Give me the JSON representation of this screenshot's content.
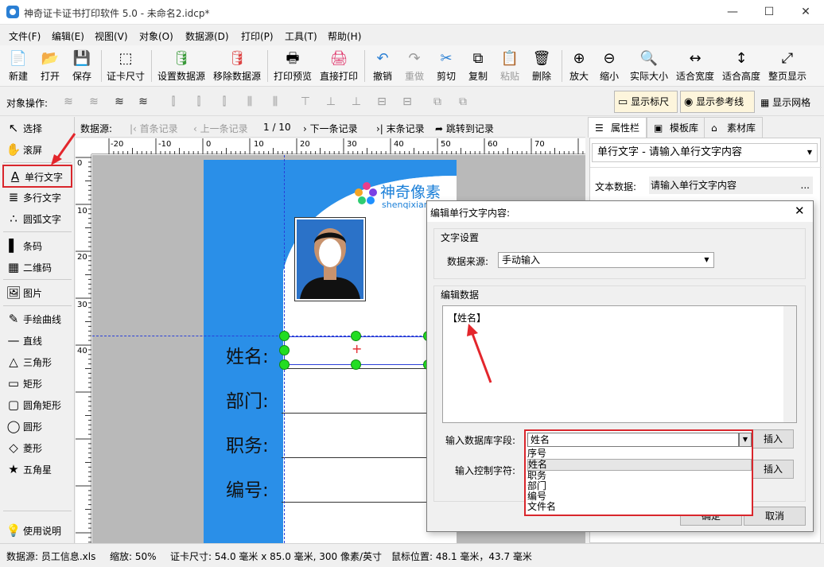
{
  "window": {
    "title": "神奇证卡证书打印软件 5.0 - 未命名2.idcp*",
    "min": "—",
    "max": "☐",
    "close": "✕"
  },
  "menu": [
    "文件(F)",
    "编辑(E)",
    "视图(V)",
    "对象(O)",
    "数据源(D)",
    "打印(P)",
    "工具(T)",
    "帮助(H)"
  ],
  "toolbar": [
    {
      "label": "新建",
      "icon": "📄"
    },
    {
      "label": "打开",
      "icon": "📂"
    },
    {
      "label": "保存",
      "icon": "💾"
    },
    {
      "label": "证卡尺寸",
      "icon": "⬚"
    },
    {
      "label": "设置数据源",
      "icon": "🛢"
    },
    {
      "label": "移除数据源",
      "icon": "🛢"
    },
    {
      "label": "打印预览",
      "icon": "🖶"
    },
    {
      "label": "直接打印",
      "icon": "🖨"
    },
    {
      "label": "撤销",
      "icon": "↶"
    },
    {
      "label": "重做",
      "icon": "↷"
    },
    {
      "label": "剪切",
      "icon": "✂"
    },
    {
      "label": "复制",
      "icon": "⧉"
    },
    {
      "label": "粘贴",
      "icon": "📋"
    },
    {
      "label": "删除",
      "icon": "🗑"
    },
    {
      "label": "放大",
      "icon": "⊕"
    },
    {
      "label": "缩小",
      "icon": "⊖"
    },
    {
      "label": "实际大小",
      "icon": "🔍"
    },
    {
      "label": "适合宽度",
      "icon": "↔"
    },
    {
      "label": "适合高度",
      "icon": "↕"
    },
    {
      "label": "整页显示",
      "icon": "⤢"
    }
  ],
  "objbar": {
    "label": "对象操作:",
    "show_ruler": "显示标尺",
    "show_guides": "显示参考线",
    "show_grid": "显示网格"
  },
  "tools": [
    {
      "label": "选择",
      "icon": "↖"
    },
    {
      "label": "滚屏",
      "icon": "✋"
    },
    {
      "label": "单行文字",
      "icon": "A"
    },
    {
      "label": "多行文字",
      "icon": "≣"
    },
    {
      "label": "圆弧文字",
      "icon": "∴"
    },
    {
      "label": "条码",
      "icon": "▌"
    },
    {
      "label": "二维码",
      "icon": "▦"
    },
    {
      "label": "图片",
      "icon": "🖼"
    },
    {
      "label": "手绘曲线",
      "icon": "✎"
    },
    {
      "label": "直线",
      "icon": "—"
    },
    {
      "label": "三角形",
      "icon": "△"
    },
    {
      "label": "矩形",
      "icon": "▭"
    },
    {
      "label": "圆角矩形",
      "icon": "▢"
    },
    {
      "label": "圆形",
      "icon": "◯"
    },
    {
      "label": "菱形",
      "icon": "◇"
    },
    {
      "label": "五角星",
      "icon": "★"
    },
    {
      "label": "使用说明",
      "icon": "💡"
    }
  ],
  "nav": {
    "label": "数据源:",
    "first": "首条记录",
    "prev": "上一条记录",
    "page": "1 / 10",
    "next": "下一条记录",
    "last": "末条记录",
    "goto": "跳转到记录"
  },
  "ruler_h": [
    "-20",
    "-10",
    "0",
    "10",
    "20",
    "30",
    "40",
    "50",
    "60",
    "70"
  ],
  "ruler_v": [
    "0",
    "10",
    "20",
    "30",
    "40"
  ],
  "card": {
    "brand": "神奇像素",
    "brand_sub": "shenqixiang",
    "fields": [
      "姓名:",
      "部门:",
      "职务:",
      "编号:"
    ]
  },
  "right_panel": {
    "tabs": [
      "属性栏",
      "模板库",
      "素材库"
    ],
    "object_select": "单行文字 - 请输入单行文字内容",
    "text_data_label": "文本数据:",
    "text_data_value": "请输入单行文字内容",
    "ellipsis": "..."
  },
  "dialog": {
    "title": "编辑单行文字内容:",
    "close": "✕",
    "group1": "文字设置",
    "source_label": "数据来源:",
    "source_value": "手动输入",
    "group2": "编辑数据",
    "content": "【姓名】",
    "db_field_label": "输入数据库字段:",
    "db_field_value": "姓名",
    "insert": "插入",
    "ctrl_label": "输入控制字符:",
    "insert2": "插入",
    "ok": "确定",
    "cancel": "取消",
    "options": [
      "序号",
      "姓名",
      "职务",
      "部门",
      "编号",
      "文件名"
    ]
  },
  "status": {
    "source": "数据源: 员工信息.xls",
    "zoom": "缩放: 50%",
    "size": "证卡尺寸: 54.0 毫米 x 85.0 毫米, 300 像素/英寸",
    "mouse": "鼠标位置: 48.1 毫米，43.7 毫米"
  },
  "colors": {
    "accent": "#2a8fe8",
    "highlight": "#d9262c",
    "handle": "#22dd22"
  }
}
